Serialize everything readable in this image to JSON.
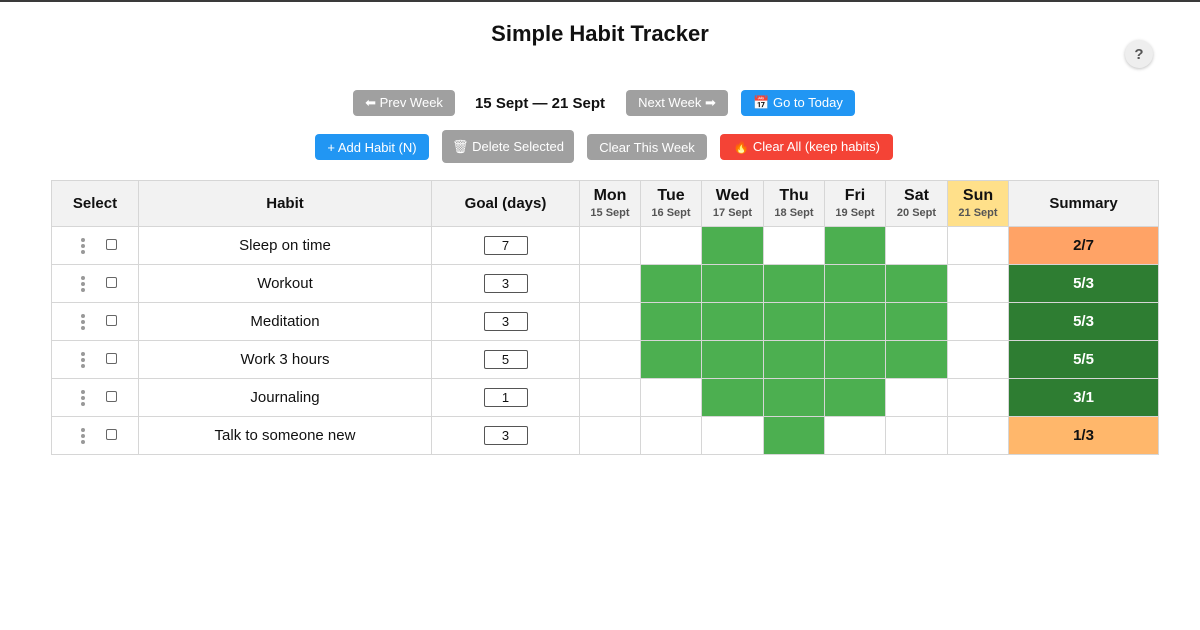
{
  "app": {
    "title": "Simple Habit Tracker",
    "help_label": "?"
  },
  "nav": {
    "prev_label": "⬅ Prev Week",
    "week_range": "15 Sept — 21 Sept",
    "next_label": "Next Week ➡",
    "today_label": "📅 Go to Today"
  },
  "actions": {
    "add_label": "+ Add Habit (N)",
    "delete_label": "🗑 Delete Selected",
    "clear_week_label": "Clear This Week",
    "clear_all_label": "🔥 Clear All (keep habits)"
  },
  "table": {
    "headers": {
      "select": "Select",
      "habit": "Habit",
      "goal": "Goal (days)",
      "summary": "Summary"
    },
    "days": [
      {
        "name": "Mon",
        "date": "15 Sept"
      },
      {
        "name": "Tue",
        "date": "16 Sept"
      },
      {
        "name": "Wed",
        "date": "17 Sept"
      },
      {
        "name": "Thu",
        "date": "18 Sept"
      },
      {
        "name": "Fri",
        "date": "19 Sept"
      },
      {
        "name": "Sat",
        "date": "20 Sept"
      },
      {
        "name": "Sun",
        "date": "21 Sept"
      }
    ],
    "today_index": 6,
    "rows": [
      {
        "habit": "Sleep on time",
        "goal": "7",
        "done": [
          false,
          false,
          true,
          false,
          true,
          false,
          false
        ],
        "summary": "2/7"
      },
      {
        "habit": "Workout",
        "goal": "3",
        "done": [
          false,
          true,
          true,
          true,
          true,
          true,
          false
        ],
        "summary": "5/3"
      },
      {
        "habit": "Meditation",
        "goal": "3",
        "done": [
          false,
          true,
          true,
          true,
          true,
          true,
          false
        ],
        "summary": "5/3"
      },
      {
        "habit": "Work 3 hours",
        "goal": "5",
        "done": [
          false,
          true,
          true,
          true,
          true,
          true,
          false
        ],
        "summary": "5/5"
      },
      {
        "habit": "Journaling",
        "goal": "1",
        "done": [
          false,
          false,
          true,
          true,
          true,
          false,
          false
        ],
        "summary": "3/1"
      },
      {
        "habit": "Talk to someone new",
        "goal": "3",
        "done": [
          false,
          false,
          false,
          true,
          false,
          false,
          false
        ],
        "summary": "1/3"
      }
    ]
  },
  "colors": {
    "done": "#4caf50",
    "goal_met": "#2e7d32",
    "goal_missed_low": "#ffa366",
    "goal_missed_mid": "#ffb76b",
    "today_header": "#ffe08a"
  }
}
